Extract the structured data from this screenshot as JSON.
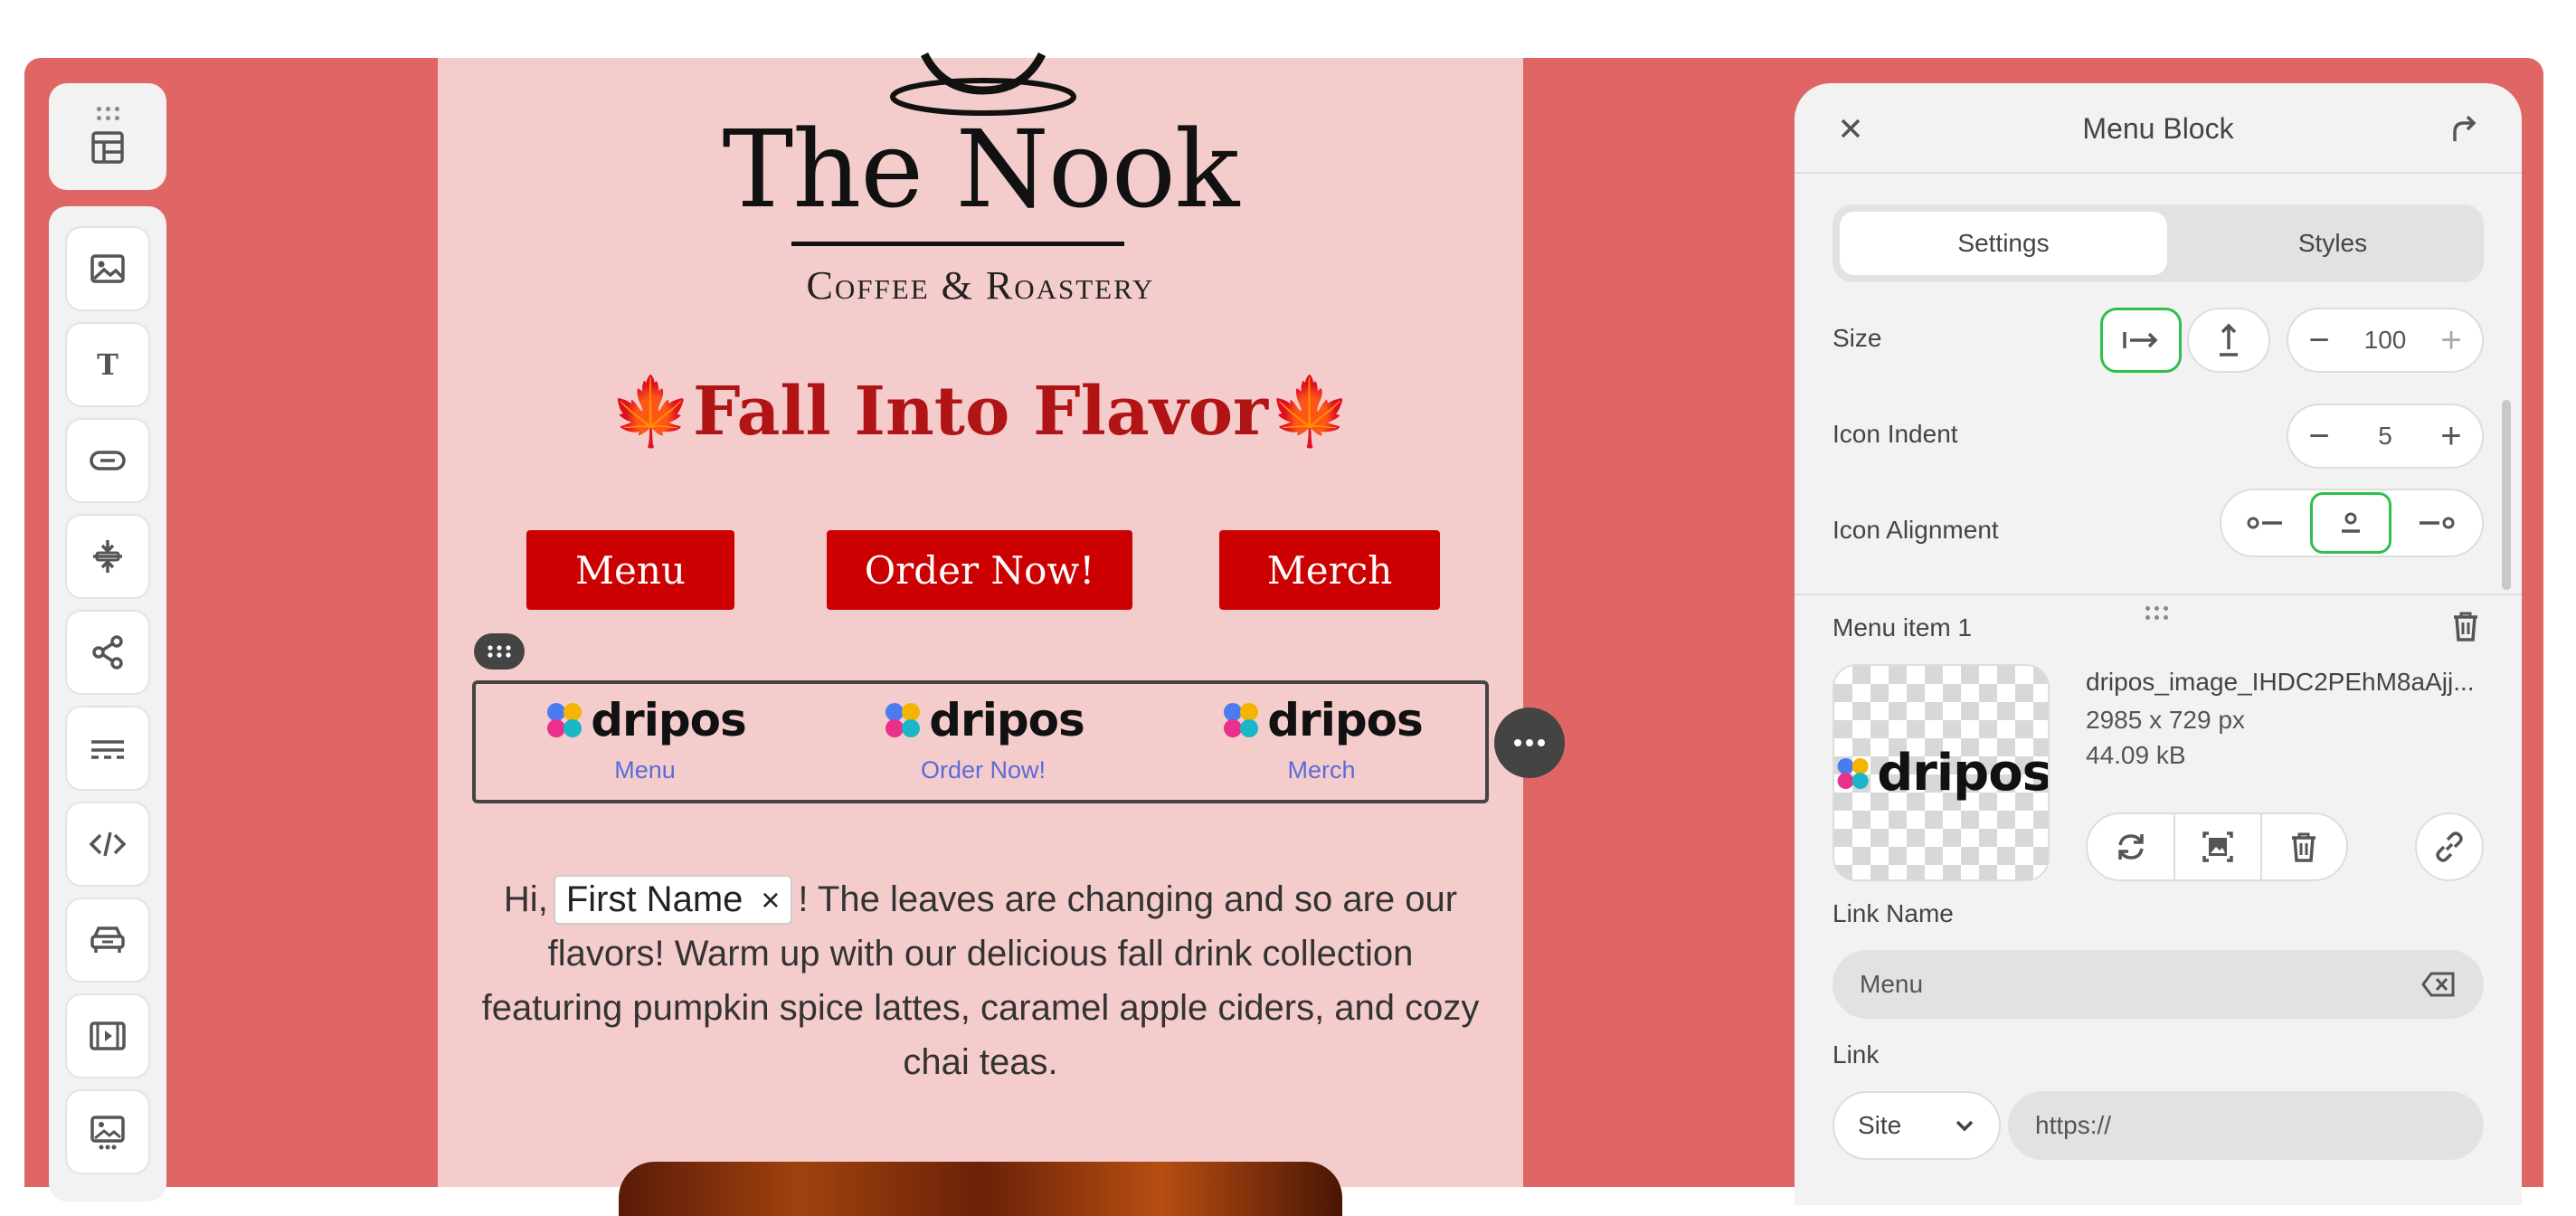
{
  "toolbar": {
    "items": [
      {
        "icon": "layout-icon"
      },
      {
        "icon": "image-icon"
      },
      {
        "icon": "text-icon"
      },
      {
        "icon": "button-icon"
      },
      {
        "icon": "spacer-icon"
      },
      {
        "icon": "share-icon"
      },
      {
        "icon": "divider-icon"
      },
      {
        "icon": "code-icon"
      },
      {
        "icon": "vehicle-icon"
      },
      {
        "icon": "video-icon"
      },
      {
        "icon": "gallery-icon"
      }
    ]
  },
  "email": {
    "brand_title": "The Nook",
    "brand_subtitle": "Coffee & Roastery",
    "headline": "🍁Fall Into Flavor🍁",
    "buttons": [
      "Menu",
      "Order Now!",
      "Merch"
    ],
    "menu_items": [
      {
        "logo_text": "dripos",
        "label": "Menu"
      },
      {
        "logo_text": "dripos",
        "label": "Order Now!"
      },
      {
        "logo_text": "dripos",
        "label": "Merch"
      }
    ],
    "paragraph": {
      "greeting": "Hi,",
      "chip": "First Name",
      "chip_remove": "×",
      "body": "! The leaves are changing and so are our flavors! Warm up with our delicious fall drink collection featuring pumpkin spice lattes, caramel apple ciders, and cozy chai teas."
    }
  },
  "panel": {
    "title": "Menu Block",
    "tabs": {
      "settings": "Settings",
      "styles": "Styles"
    },
    "size": {
      "label": "Size",
      "value": "100"
    },
    "icon_indent": {
      "label": "Icon Indent",
      "value": "5"
    },
    "icon_alignment": {
      "label": "Icon Alignment",
      "selected": "center"
    },
    "menu_item": {
      "heading": "Menu item 1",
      "logo_text": "dripos",
      "file_name": "dripos_image_IHDC2PEhM8aAjj...",
      "file_dimensions": "2985 x 729 px",
      "file_size": "44.09 kB",
      "link_name_label": "Link Name",
      "link_name_value": "Menu",
      "link_label": "Link",
      "link_type": "Site",
      "link_placeholder": "https://"
    }
  },
  "colors": {
    "canvas": "#e06666",
    "email_bg": "#f4cccc",
    "cta": "#cc0000",
    "headline": "#b01414",
    "menu_label": "#5b6bd6",
    "selected_outline": "#2fbf4a"
  }
}
